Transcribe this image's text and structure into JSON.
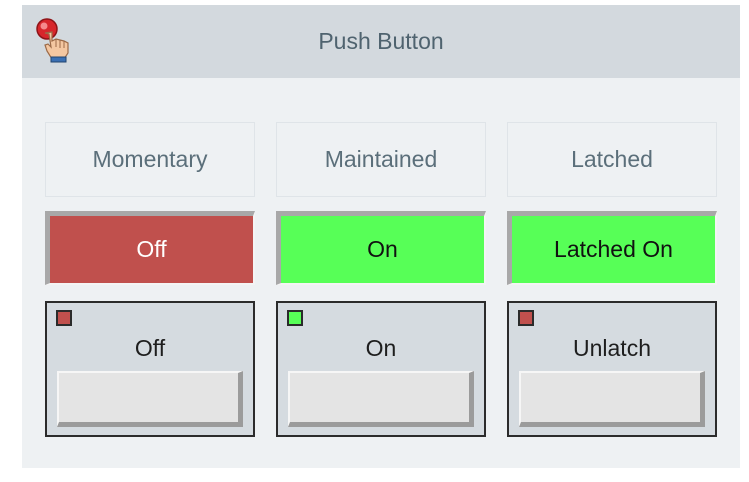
{
  "window": {
    "title": "Push Button",
    "icon": "push-button-hand-icon"
  },
  "columns": [
    {
      "header": "Momentary",
      "indicator": {
        "text": "Off",
        "color": "#c0504d"
      },
      "button": {
        "label": "Off",
        "led_color": "#c0504d"
      }
    },
    {
      "header": "Maintained",
      "indicator": {
        "text": "On",
        "color": "#57ff57"
      },
      "button": {
        "label": "On",
        "led_color": "#57ff57"
      }
    },
    {
      "header": "Latched",
      "indicator": {
        "text": "Latched On",
        "color": "#57ff57"
      },
      "button": {
        "label": "Unlatch",
        "led_color": "#c0504d"
      }
    }
  ],
  "colors": {
    "title_bar": "#d3d9de",
    "panel_background": "#eef1f3",
    "off_red": "#c0504d",
    "on_green": "#57ff57"
  }
}
